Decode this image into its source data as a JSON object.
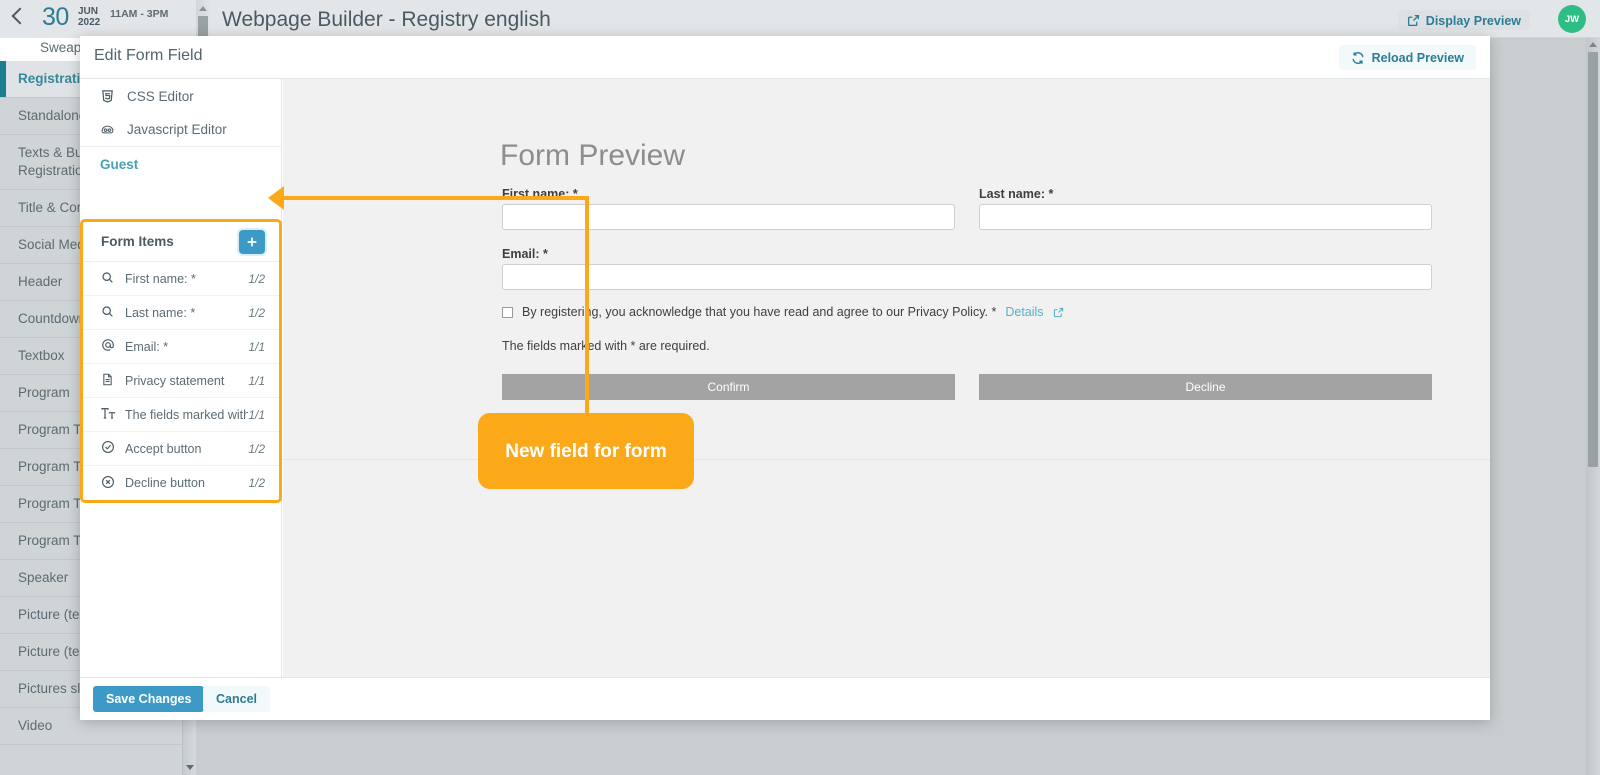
{
  "topbar": {
    "back_icon": "chevron-left-icon",
    "date_day": "30",
    "date_month": "JUN",
    "date_year": "2022",
    "date_time": "11AM - 3PM",
    "event_name": "Sweap",
    "app_title": "Webpage Builder - Registry english",
    "display_preview_label": "Display Preview",
    "display_preview_icon": "external-link-icon",
    "avatar_initials": "JW"
  },
  "sidebar": {
    "items": [
      {
        "label": "Registration",
        "active": true
      },
      {
        "label": "Standalone (optional)",
        "active": false
      },
      {
        "label": "Texts & Buttons Registration",
        "active": false
      },
      {
        "label": "Title & Corp",
        "active": false
      },
      {
        "label": "Social Media",
        "active": false
      },
      {
        "label": "Header",
        "active": false
      },
      {
        "label": "Countdown",
        "active": false
      },
      {
        "label": "Textbox",
        "active": false
      },
      {
        "label": "Program",
        "active": false
      },
      {
        "label": "Program Ta",
        "active": false
      },
      {
        "label": "Program Tab",
        "active": false
      },
      {
        "label": "Program Tab",
        "active": false
      },
      {
        "label": "Program Tab",
        "active": false
      },
      {
        "label": "Speaker",
        "active": false
      },
      {
        "label": "Picture (text",
        "active": false
      },
      {
        "label": "Picture (text",
        "active": false
      },
      {
        "label": "Pictures slid",
        "active": false
      },
      {
        "label": "Video",
        "active": false
      }
    ]
  },
  "modal": {
    "title": "Edit Form Field",
    "reload_preview_label": "Reload Preview",
    "reload_preview_icon": "refresh-icon",
    "editors": [
      {
        "label": "CSS Editor",
        "icon": "css3-icon"
      },
      {
        "label": "Javascript Editor",
        "icon": "javascript-icon"
      }
    ],
    "section_label": "Guest",
    "form_items": {
      "title": "Form Items",
      "add_button_label": "+",
      "add_button_icon": "plus-icon",
      "rows": [
        {
          "label": "First name: *",
          "fraction": "1/2",
          "icon": "search-icon"
        },
        {
          "label": "Last name: *",
          "fraction": "1/2",
          "icon": "search-icon"
        },
        {
          "label": "Email: *",
          "fraction": "1/1",
          "icon": "at-sign-icon"
        },
        {
          "label": "Privacy statement",
          "fraction": "1/1",
          "icon": "document-icon"
        },
        {
          "label": "The fields marked with…",
          "fraction": "1/1",
          "icon": "text-format-icon"
        },
        {
          "label": "Accept button",
          "fraction": "1/2",
          "icon": "check-circle-icon"
        },
        {
          "label": "Decline button",
          "fraction": "1/2",
          "icon": "x-circle-icon"
        }
      ]
    },
    "save_label": "Save Changes",
    "cancel_label": "Cancel"
  },
  "preview": {
    "title": "Form Preview",
    "first_name_label": "First name: *",
    "last_name_label": "Last name: *",
    "email_label": "Email: *",
    "first_name_value": "",
    "last_name_value": "",
    "email_value": "",
    "consent_text": "By registering, you acknowledge that you have read and agree to our Privacy Policy. *",
    "consent_link": "Details",
    "consent_link_icon": "external-link-icon",
    "required_note": "The fields marked with * are required.",
    "confirm_label": "Confirm",
    "decline_label": "Decline"
  },
  "annotation": {
    "text": "New field for form",
    "color": "#FBA919"
  }
}
